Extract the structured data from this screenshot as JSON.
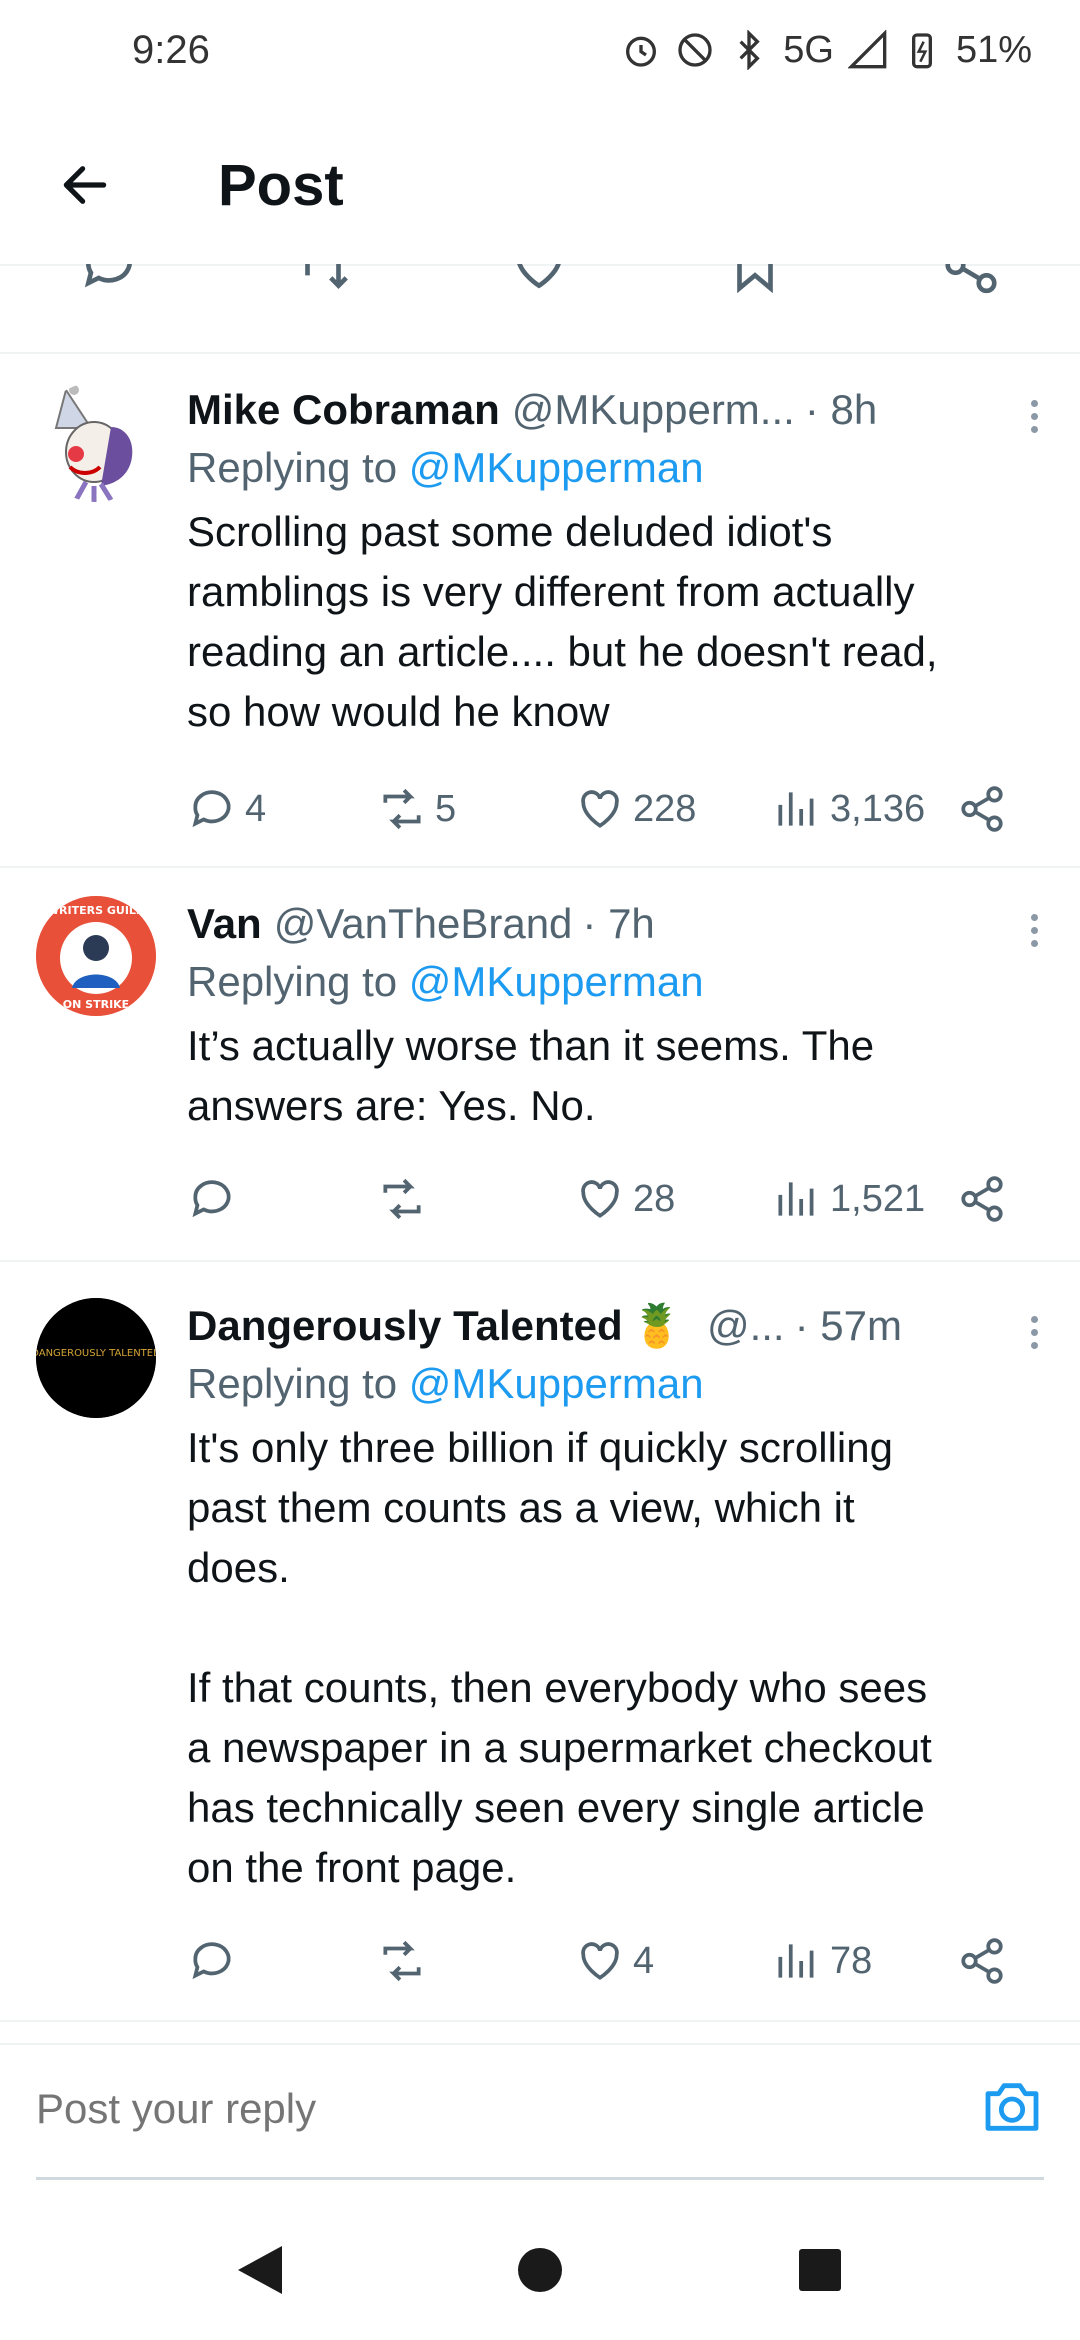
{
  "status_bar": {
    "time": "9:26",
    "network": "5G",
    "battery": "51%"
  },
  "header": {
    "title": "Post",
    "back_icon": "arrow-left-icon"
  },
  "previous_actions": [
    "reply-icon",
    "repost-icon",
    "like-icon",
    "bookmark-icon",
    "share-icon"
  ],
  "tweets": [
    {
      "name": "Mike Cobraman",
      "handle": "@MKupperm...",
      "time": "· 8h",
      "replying_prefix": "Replying to ",
      "replying_to": "@MKupperman",
      "text": "Scrolling past some deluded idiot's\nramblings is very different from actually\nreading an article.... but he doesn't read,\nso how would he know",
      "replies": "4",
      "reposts": "5",
      "likes": "228",
      "views": "3,136"
    },
    {
      "name": "Van",
      "handle": "@VanTheBrand",
      "time": "· 7h",
      "replying_prefix": "Replying to ",
      "replying_to": "@MKupperman",
      "text": "It’s actually worse than it seems. The\nanswers are: Yes. No.",
      "replies": "",
      "reposts": "",
      "likes": "28",
      "views": "1,521",
      "avatar_text_top": "WRITERS GUILD",
      "avatar_text_bottom": "ON STRIKE"
    },
    {
      "name": "Dangerously Talented",
      "name_emoji": "🍍",
      "handle": "@...",
      "time": "· 57m",
      "replying_prefix": "Replying to ",
      "replying_to": "@MKupperman",
      "text": "It's only three billion if quickly scrolling\npast them counts as a view, which it\ndoes.\n\nIf that counts, then everybody who sees\na newspaper in a supermarket checkout\nhas technically seen every single article\non the front page.",
      "replies": "",
      "reposts": "",
      "likes": "4",
      "views": "78",
      "avatar_text": "DANGEROUSLY TALENTED"
    }
  ],
  "reply_bar": {
    "placeholder": "Post your reply"
  },
  "colors": {
    "accent": "#1d9bf0",
    "secondary_text": "#536471",
    "divider": "#eff3f4"
  }
}
